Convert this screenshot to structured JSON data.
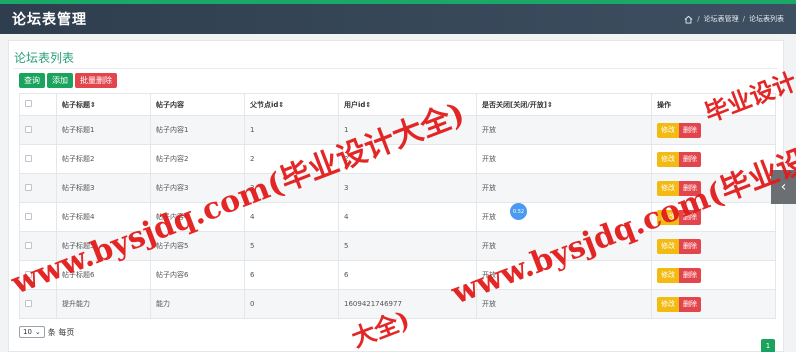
{
  "header": {
    "title": "论坛表管理",
    "breadcrumb": [
      "论坛表管理",
      "论坛表列表"
    ]
  },
  "card": {
    "title": "论坛表列表"
  },
  "toolbar": {
    "query": "查询",
    "add": "添加",
    "batch_delete": "批量删除"
  },
  "table": {
    "headers": [
      "帖子标题",
      "帖子内容",
      "父节点id",
      "用户id",
      "是否关闭[关闭/开放]",
      "操作"
    ],
    "rows": [
      [
        "帖子标题1",
        "帖子内容1",
        "1",
        "1",
        "开放"
      ],
      [
        "帖子标题2",
        "帖子内容2",
        "2",
        "2",
        "开放"
      ],
      [
        "帖子标题3",
        "帖子内容3",
        "3",
        "3",
        "开放"
      ],
      [
        "帖子标题4",
        "帖子内容4",
        "4",
        "4",
        "开放"
      ],
      [
        "帖子标题5",
        "帖子内容5",
        "5",
        "5",
        "开放"
      ],
      [
        "帖子标题6",
        "帖子内容6",
        "6",
        "6",
        "开放"
      ],
      [
        "提升能力",
        "能力",
        "0",
        "1609421746977",
        "开放"
      ]
    ],
    "edit_label": "修改",
    "delete_label": "删除"
  },
  "pager": {
    "page_size": "10",
    "page_size_suffix": "条 每页",
    "current_page": "1"
  },
  "badge": "0.52",
  "watermarks": [
    "www.bysjdq.com(毕业设计大全)",
    "www.bysjdq.com(毕业设计",
    "大全)",
    "毕业设计"
  ],
  "colors": {
    "accent": "#1aa35c",
    "danger": "#e3454d",
    "warning": "#f3ba11",
    "header": "#2f3e4e"
  }
}
